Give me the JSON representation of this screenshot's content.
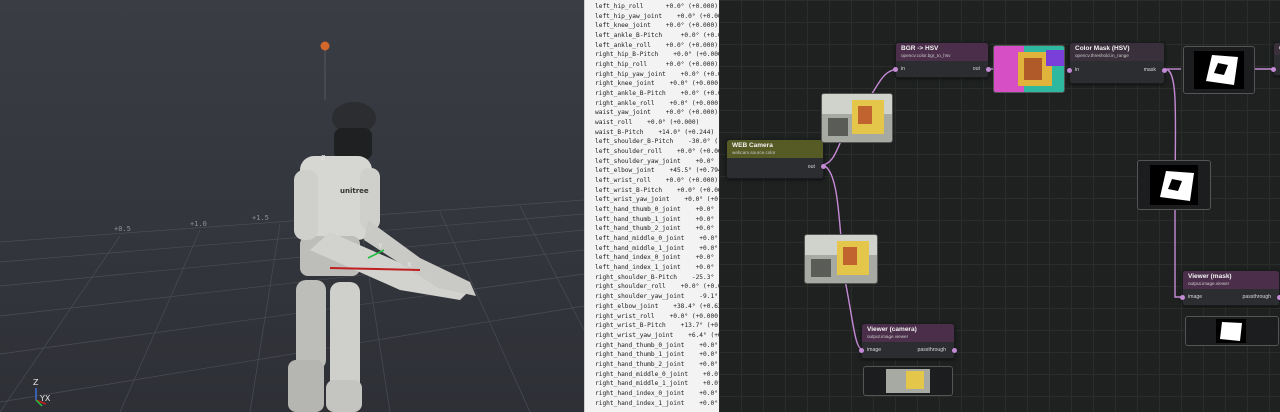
{
  "viewport": {
    "grid_labels": [
      "+0.5",
      "+1.0",
      "+1.5"
    ],
    "robot_chest_text": "unitree",
    "axes": {
      "z": "Z",
      "yx": "YX"
    },
    "tf_labels": [
      "Z",
      "Y",
      "X"
    ]
  },
  "joint_panel": {
    "rows": [
      "left_hip_roll      +0.0° (+0.000)",
      "left_hip_yaw_joint    +0.0° (+0.000",
      "left_knee_joint    +0.0° (+0.000)",
      "left_ankle_B-Pitch     +0.0° (+0.000",
      "left_ankle_roll    +0.0° (+0.000)",
      "right_hip_B-Pitch    +0.0° (+0.000)",
      "right_hip_roll     +0.0° (+0.000)",
      "right_hip_yaw_joint    +0.0° (+0.000",
      "right_knee_joint    +0.0° (+0.000)",
      "right_ankle_B-Pitch    +0.0° (+0.00",
      "right_ankle_roll    +0.0° (+0.000)",
      "waist_yaw_joint    +0.0° (+0.000)",
      "waist_roll    +0.0° (+0.000)",
      "waist_B-Pitch    +14.0° (+0.244)",
      "left_shoulder_B-Pitch    -30.0° (-0.",
      "left_shoulder_roll    +0.0° (+0.000",
      "left_shoulder_yaw_joint    +0.0° (+0.",
      "left_elbow_joint    +45.5° (+0.794)",
      "left_wrist_roll    +0.0° (+0.000)",
      "left_wrist_B-Pitch    +0.0° (+0.000)",
      "left_wrist_yaw_joint    +0.0° (+0.00",
      "left_hand_thumb_0_joint    +0.0° (+",
      "left_hand_thumb_1_joint    +0.0° (",
      "left_hand_thumb_2_joint    +0.0° (+",
      "left_hand_middle_0_joint    +0.0° (",
      "left_hand_middle_1_joint    +0.0° (",
      "left_hand_index_0_joint    +0.0° (+",
      "left_hand_index_1_joint    +0.0° (+",
      "right_shoulder_B-Pitch    -25.3° (-0",
      "right_shoulder_roll    +0.0° (+0.00",
      "right_shoulder_yaw_joint    -9.1° (",
      "right_elbow_joint    +38.4° (+0.635)",
      "right_wrist_roll    +0.0° (+0.000)",
      "right_wrist_B-Pitch    +13.7° (+0.23",
      "right_wrist_yaw_joint    +6.4° (+0.",
      "right_hand_thumb_0_joint    +0.0° (",
      "right_hand_thumb_1_joint    +0.0° (",
      "right_hand_thumb_2_joint    +0.0° (",
      "right_hand_middle_0_joint    +0.0°",
      "right_hand_middle_1_joint    +0.0°",
      "right_hand_index_0_joint    +0.0° (",
      "right_hand_index_1_joint    +0.0° ("
    ]
  },
  "nodes": {
    "web_camera": {
      "title": "WEB Camera",
      "subtitle": "webcam.source.color",
      "out": "out",
      "color": "#565a24"
    },
    "bgr_hsv": {
      "title": "BGR -> HSV",
      "subtitle": "opencv.color.bgr_to_hsv",
      "in": "in",
      "out": "out",
      "color": "#4b2f4a"
    },
    "color_mask": {
      "title": "Color Mask (HSV)",
      "subtitle": "opencv.threshold.in_range",
      "in": "in",
      "out": "mask",
      "color": "#3a303b"
    },
    "viewer_camera": {
      "title": "Viewer (camera)",
      "subtitle": "output.image.viewer",
      "in": "image",
      "out": "passthrough",
      "color": "#4b2f4a"
    },
    "viewer_mask": {
      "title": "Viewer (mask)",
      "subtitle": "output.image.viewer",
      "in": "image",
      "out": "passthrough",
      "color": "#4b2f4a"
    },
    "edge_node": {
      "title": "C"
    }
  },
  "colors": {
    "wire": "#c58ad6",
    "port": "#c58ad6"
  }
}
